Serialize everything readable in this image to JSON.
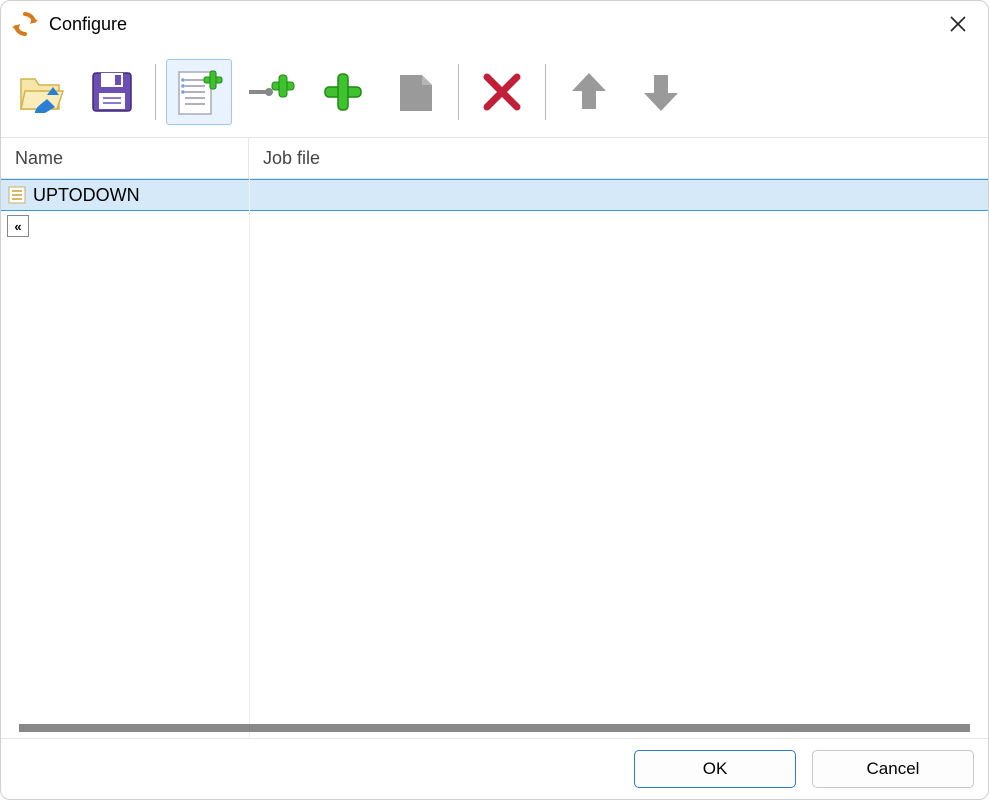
{
  "window": {
    "title": "Configure"
  },
  "toolbar": {
    "icons": {
      "open": "open-folder-icon",
      "save": "save-icon",
      "add_group": "add-group-icon",
      "add_link": "add-link-icon",
      "add": "add-icon",
      "edit": "edit-icon",
      "delete": "delete-icon",
      "move_up": "up-arrow-icon",
      "move_down": "down-arrow-icon"
    }
  },
  "columns": {
    "name": "Name",
    "job_file": "Job file"
  },
  "rows": [
    {
      "name": "UPTODOWN",
      "job_file": "",
      "selected": true,
      "icon": "group-icon"
    },
    {
      "name": "",
      "job_file": "",
      "selected": false,
      "icon": "collapse-icon",
      "icon_label": "«"
    }
  ],
  "buttons": {
    "ok": "OK",
    "cancel": "Cancel"
  }
}
